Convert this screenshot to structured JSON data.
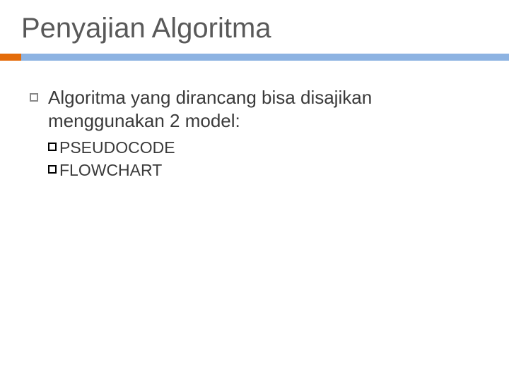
{
  "title": "Penyajian Algoritma",
  "main_bullet": "Algoritma yang dirancang bisa disajikan menggunakan 2 model:",
  "sub_items": {
    "0": "PSEUDOCODE",
    "1": "FLOWCHART"
  }
}
